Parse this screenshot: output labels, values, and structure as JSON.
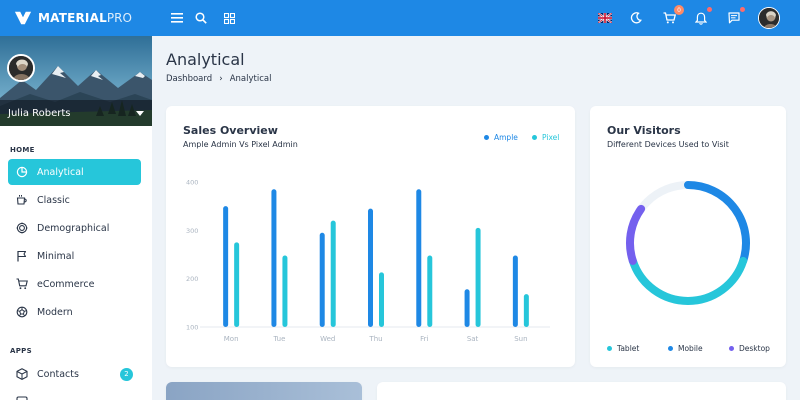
{
  "brand": {
    "name": "MATERIAL",
    "suffix": "PRO"
  },
  "user": {
    "name": "Julia Roberts"
  },
  "topbar": {
    "icons": [
      "menu-icon",
      "search-icon",
      "apps-grid-icon",
      "uk-flag-icon",
      "moon-icon",
      "cart-icon",
      "bell-icon",
      "message-icon"
    ],
    "cart_count": "0"
  },
  "sidebar": {
    "home_caption": "HOME",
    "apps_caption": "APPS",
    "home_items": [
      {
        "label": "Analytical",
        "icon": "pie-chart-icon",
        "active": true
      },
      {
        "label": "Classic",
        "icon": "cup-icon",
        "active": false
      },
      {
        "label": "Demographical",
        "icon": "target-icon",
        "active": false
      },
      {
        "label": "Minimal",
        "icon": "flag-icon",
        "active": false
      },
      {
        "label": "eCommerce",
        "icon": "cart-icon",
        "active": false
      },
      {
        "label": "Modern",
        "icon": "soccer-ball-icon",
        "active": false
      }
    ],
    "app_items": [
      {
        "label": "Contacts",
        "icon": "box-icon",
        "badge": "2"
      }
    ]
  },
  "page": {
    "title": "Analytical",
    "breadcrumb": [
      "Dashboard",
      "Analytical"
    ]
  },
  "sales_card": {
    "title": "Sales Overview",
    "subtitle": "Ample Admin Vs Pixel Admin",
    "legend": [
      {
        "name": "Ample",
        "color": "#1e88e5"
      },
      {
        "name": "Pixel",
        "color": "#26c6da"
      }
    ]
  },
  "visitors_card": {
    "title": "Our Visitors",
    "subtitle": "Different Devices Used to Visit",
    "legend": [
      {
        "name": "Tablet",
        "color": "#26c6da"
      },
      {
        "name": "Mobile",
        "color": "#1e88e5"
      },
      {
        "name": "Desktop",
        "color": "#7460ee"
      }
    ]
  },
  "chart_data": [
    {
      "type": "bar",
      "categories": [
        "Mon",
        "Tue",
        "Wed",
        "Thu",
        "Fri",
        "Sat",
        "Sun"
      ],
      "series": [
        {
          "name": "Ample",
          "color": "#1e88e5",
          "values": [
            350,
            385,
            295,
            345,
            385,
            178,
            248
          ]
        },
        {
          "name": "Pixel",
          "color": "#26c6da",
          "values": [
            275,
            248,
            320,
            213,
            248,
            305,
            168
          ]
        }
      ],
      "yticks": [
        100,
        200,
        300,
        400
      ],
      "ylim": [
        100,
        400
      ]
    },
    {
      "type": "pie",
      "donut": true,
      "categories": [
        "Tablet",
        "Mobile",
        "Desktop"
      ],
      "values": [
        40,
        30,
        15
      ],
      "colors": [
        "#26c6da",
        "#1e88e5",
        "#7460ee"
      ]
    }
  ]
}
